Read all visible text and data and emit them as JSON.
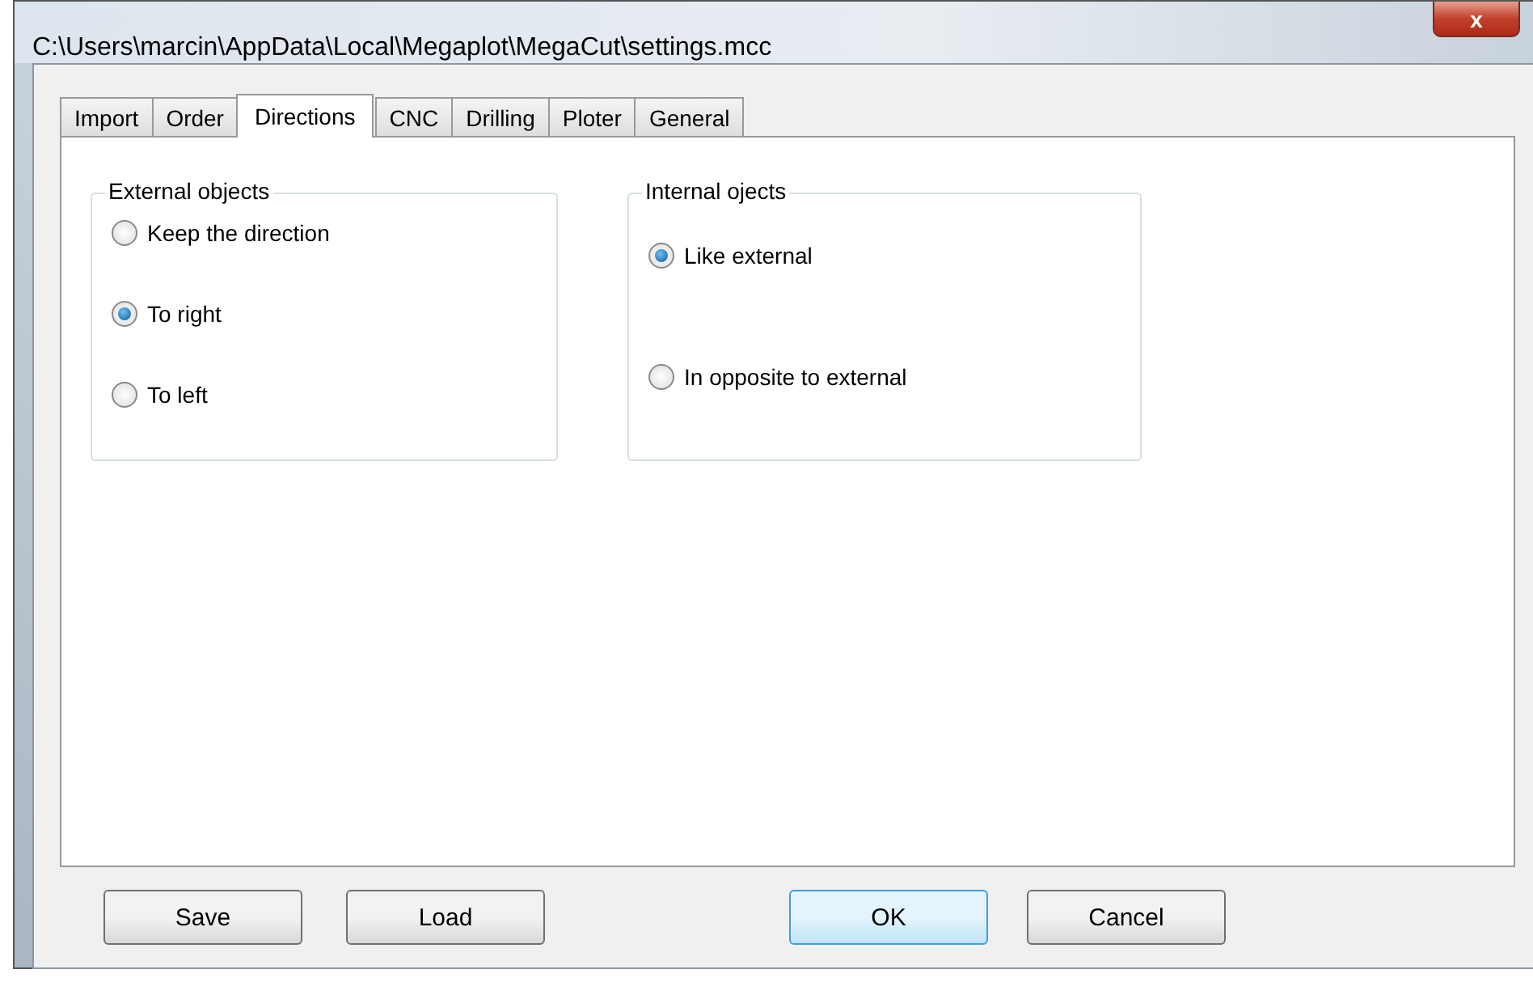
{
  "window": {
    "title": "C:\\Users\\marcin\\AppData\\Local\\Megaplot\\MegaCut\\settings.mcc",
    "close": "x"
  },
  "tabs": [
    {
      "label": "Import",
      "selected": false
    },
    {
      "label": "Order",
      "selected": false
    },
    {
      "label": "Directions",
      "selected": true
    },
    {
      "label": "CNC",
      "selected": false
    },
    {
      "label": "Drilling",
      "selected": false
    },
    {
      "label": "Ploter",
      "selected": false
    },
    {
      "label": "General",
      "selected": false
    }
  ],
  "groups": [
    {
      "title": "External objects",
      "options": [
        {
          "label": "Keep the direction",
          "selected": false
        },
        {
          "label": "To right",
          "selected": true
        },
        {
          "label": "To left",
          "selected": false
        }
      ]
    },
    {
      "title": "Internal ojects",
      "options": [
        {
          "label": "Like external",
          "selected": true
        },
        {
          "label": "In opposite to external",
          "selected": false
        }
      ]
    }
  ],
  "buttons": [
    {
      "label": "Save",
      "default": false
    },
    {
      "label": "Load",
      "default": false
    },
    {
      "label": "OK",
      "default": true
    },
    {
      "label": "Cancel",
      "default": false
    }
  ]
}
